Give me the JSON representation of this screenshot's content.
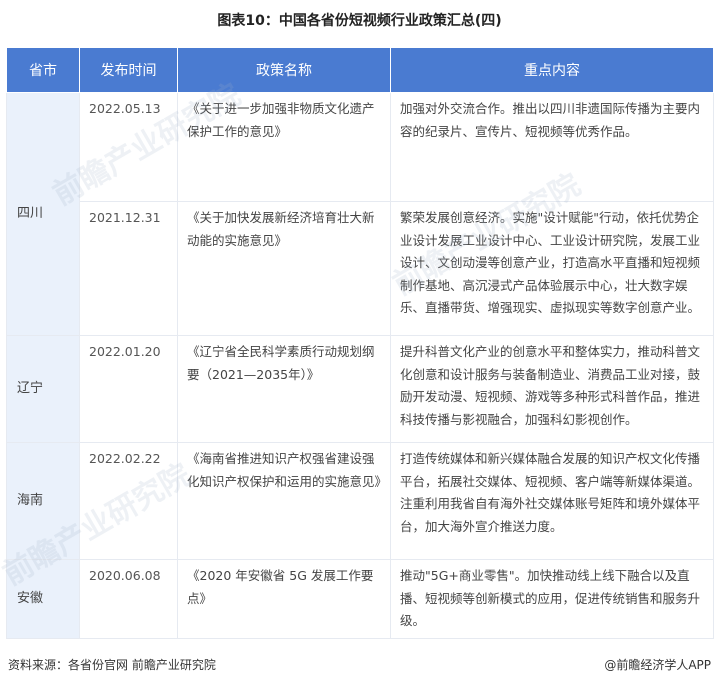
{
  "title": "图表10：中国各省份短视频行业政策汇总(四)",
  "table": {
    "headers": [
      "省市",
      "发布时间",
      "政策名称",
      "重点内容"
    ],
    "groups": [
      {
        "province": "四川",
        "rows": [
          {
            "date": "2022.05.13",
            "policy": "《关于进一步加强非物质文化遗产保护工作的意见》",
            "content": "加强对外交流合作。推出以四川非遗国际传播为主要内容的纪录片、宣传片、短视频等优秀作品。"
          },
          {
            "date": "2021.12.31",
            "policy": "《关于加快发展新经济培育壮大新动能的实施意见》",
            "content": "繁荣发展创意经济。实施\"设计赋能\"行动，依托优势企业设计发展工业设计中心、工业设计研究院，发展工业设计、文创动漫等创意产业，打造高水平直播和短视频制作基地、高沉浸式产品体验展示中心，壮大数字娱乐、直播带货、增强现实、虚拟现实等数字创意产业。"
          }
        ]
      },
      {
        "province": "辽宁",
        "rows": [
          {
            "date": "2022.01.20",
            "policy": "《辽宁省全民科学素质行动规划纲要（2021—2035年）》",
            "content": "提升科普文化产业的创意水平和整体实力，推动科普文化创意和设计服务与装备制造业、消费品工业对接，鼓励开发动漫、短视频、游戏等多种形式科普作品，推进科技传播与影视融合，加强科幻影视创作。"
          }
        ]
      },
      {
        "province": "海南",
        "rows": [
          {
            "date": "2022.02.22",
            "policy": "《海南省推进知识产权强省建设强化知识产权保护和运用的实施意见》",
            "content": "打造传统媒体和新兴媒体融合发展的知识产权文化传播平台，拓展社交媒体、短视频、客户端等新媒体渠道。注重利用我省自有海外社交媒体账号矩阵和境外媒体平台，加大海外宣介推送力度。"
          }
        ]
      },
      {
        "province": "安徽",
        "rows": [
          {
            "date": "2020.06.08",
            "policy": "《2020 年安徽省 5G 发展工作要点》",
            "content": "推动\"5G+商业零售\"。加快推动线上线下融合以及直播、短视频等创新模式的应用，促进传统销售和服务升级。"
          }
        ]
      }
    ]
  },
  "footer": {
    "source": "资料来源：各省份官网 前瞻产业研究院",
    "brand": "@前瞻经济学人APP"
  },
  "watermark": "前瞻产业研究院"
}
